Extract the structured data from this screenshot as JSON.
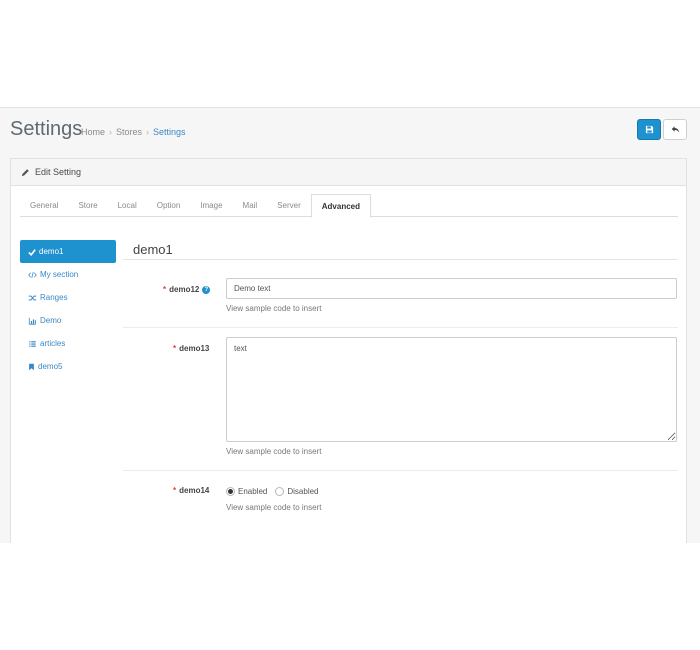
{
  "header": {
    "title": "Settings",
    "breadcrumbs": [
      "Home",
      "Stores",
      "Settings"
    ],
    "breadcrumb_separator": "›",
    "save_icon": "save-icon",
    "back_icon": "reply-icon"
  },
  "panel": {
    "heading": "Edit Setting",
    "heading_icon": "pencil-icon"
  },
  "tabs": [
    {
      "label": "General"
    },
    {
      "label": "Store"
    },
    {
      "label": "Local"
    },
    {
      "label": "Option"
    },
    {
      "label": "Image"
    },
    {
      "label": "Mail"
    },
    {
      "label": "Server"
    },
    {
      "label": "Advanced"
    }
  ],
  "sidebar": {
    "items": [
      {
        "label": "demo1",
        "icon": "check-icon"
      },
      {
        "label": "My section",
        "icon": "code-icon"
      },
      {
        "label": "Ranges",
        "icon": "random-icon"
      },
      {
        "label": "Demo",
        "icon": "bar-chart-icon"
      },
      {
        "label": "articles",
        "icon": "list-icon"
      },
      {
        "label": "demo5",
        "icon": "bookmark-icon"
      }
    ]
  },
  "form": {
    "section_title": "demo1",
    "fields": [
      {
        "label": "demo12",
        "value": "Demo text",
        "help": "View sample code to insert"
      },
      {
        "label": "demo13",
        "value": "text",
        "help": "View sample code to insert"
      },
      {
        "label": "demo14",
        "options": [
          "Enabled",
          "Disabled"
        ],
        "selected": "Enabled",
        "help": "View sample code to insert"
      }
    ],
    "required_mark": "*",
    "help_icon_glyph": "?"
  },
  "colors": {
    "primary": "#1e91cf",
    "link": "#3a88c6",
    "required": "#e3403a"
  }
}
